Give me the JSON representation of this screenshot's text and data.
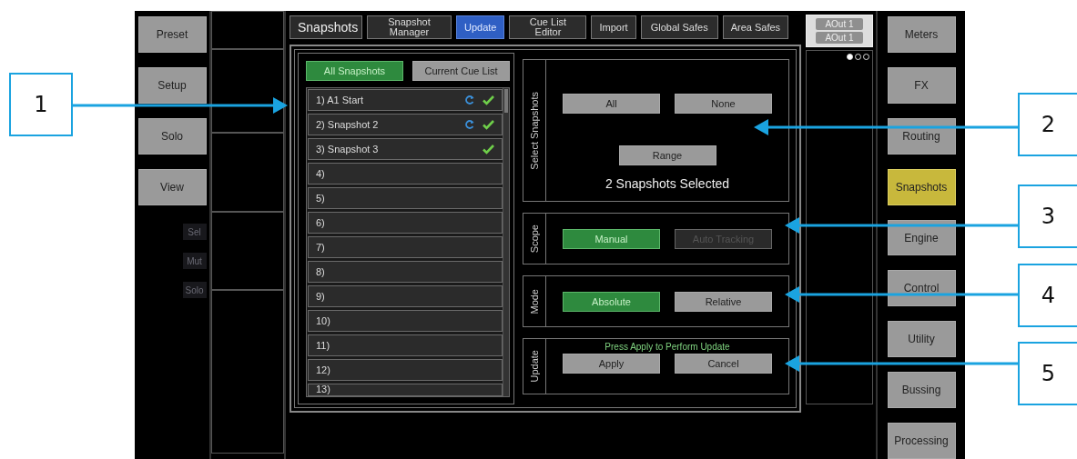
{
  "left_nav": [
    {
      "label": "Preset",
      "selected": false
    },
    {
      "label": "Setup",
      "selected": false
    },
    {
      "label": "Solo",
      "selected": false
    },
    {
      "label": "View",
      "selected": false
    }
  ],
  "channel_buttons": [
    {
      "label": "Sel"
    },
    {
      "label": "Mut"
    },
    {
      "label": "Solo"
    }
  ],
  "title": "Snapshots",
  "tabs": [
    {
      "label": "Snapshot Manager",
      "selected": false
    },
    {
      "label": "Update",
      "selected": true
    },
    {
      "label": "Cue List Editor",
      "selected": false
    },
    {
      "label": "Import",
      "selected": false
    },
    {
      "label": "Global Safes",
      "selected": false
    },
    {
      "label": "Area Safes",
      "selected": false
    }
  ],
  "outputs": [
    "AOut 1",
    "AOut 1"
  ],
  "pages": [
    {
      "selected": true
    },
    {
      "selected": false
    },
    {
      "selected": false
    }
  ],
  "list_filters": [
    {
      "label": "All Snapshots",
      "selected": true
    },
    {
      "label": "Current Cue List",
      "selected": false
    }
  ],
  "snapshots": [
    {
      "label": "1) A1 Start",
      "recall": true,
      "checked": true
    },
    {
      "label": "2) Snapshot 2",
      "recall": true,
      "checked": true
    },
    {
      "label": "3) Snapshot 3",
      "recall": false,
      "checked": true
    },
    {
      "label": "4)",
      "recall": false,
      "checked": false
    },
    {
      "label": "5)",
      "recall": false,
      "checked": false
    },
    {
      "label": "6)",
      "recall": false,
      "checked": false
    },
    {
      "label": "7)",
      "recall": false,
      "checked": false
    },
    {
      "label": "8)",
      "recall": false,
      "checked": false
    },
    {
      "label": "9)",
      "recall": false,
      "checked": false
    },
    {
      "label": "10)",
      "recall": false,
      "checked": false
    },
    {
      "label": "11)",
      "recall": false,
      "checked": false
    },
    {
      "label": "12)",
      "recall": false,
      "checked": false
    },
    {
      "label": "13)",
      "recall": false,
      "checked": false
    }
  ],
  "select_snapshots": {
    "title": "Select Snapshots",
    "buttons": [
      "All",
      "None",
      "Range"
    ],
    "status": "2 Snapshots Selected"
  },
  "scope": {
    "title": "Scope",
    "options": [
      {
        "label": "Manual",
        "selected": true,
        "disabled": false
      },
      {
        "label": "Auto Tracking",
        "selected": false,
        "disabled": true
      }
    ]
  },
  "mode": {
    "title": "Mode",
    "options": [
      {
        "label": "Absolute",
        "selected": true
      },
      {
        "label": "Relative",
        "selected": false
      }
    ]
  },
  "update": {
    "title": "Update",
    "message": "Press Apply to Perform Update",
    "buttons": [
      "Apply",
      "Cancel"
    ]
  },
  "right_nav": [
    {
      "label": "Meters",
      "selected": false
    },
    {
      "label": "FX",
      "selected": false
    },
    {
      "label": "Routing",
      "selected": false
    },
    {
      "label": "Snapshots",
      "selected": true
    },
    {
      "label": "Engine",
      "selected": false
    },
    {
      "label": "Control",
      "selected": false
    },
    {
      "label": "Utility",
      "selected": false
    },
    {
      "label": "Bussing",
      "selected": false
    },
    {
      "label": "Processing",
      "selected": false
    }
  ],
  "callouts": [
    {
      "label": "1"
    },
    {
      "label": "2"
    },
    {
      "label": "3"
    },
    {
      "label": "4"
    },
    {
      "label": "5"
    }
  ]
}
